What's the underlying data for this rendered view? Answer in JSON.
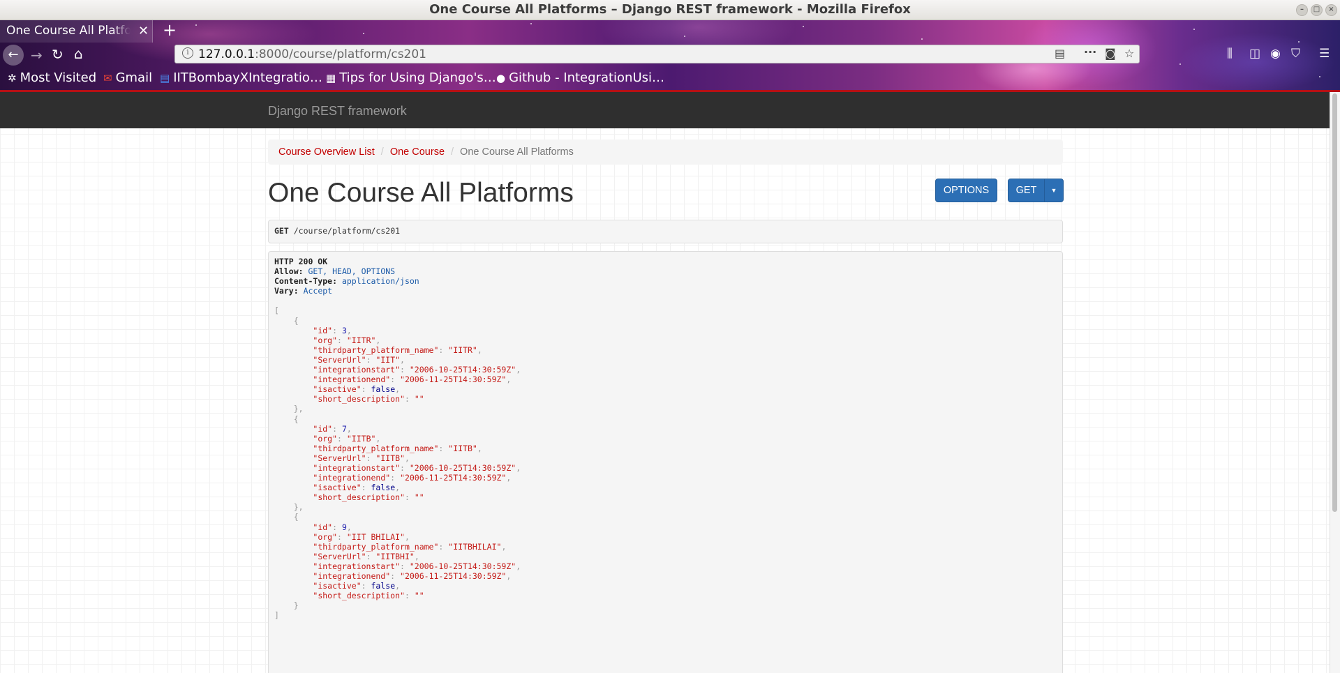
{
  "window": {
    "title": "One Course All Platforms – Django REST framework - Mozilla Firefox"
  },
  "browser": {
    "tab_title": "One Course All Platforms",
    "url_host": "127.0.0.1",
    "url_path": ":8000/course/platform/cs201",
    "bookmarks": [
      {
        "label": "Most Visited",
        "icon": "gear-icon"
      },
      {
        "label": "Gmail",
        "icon": "gmail-icon"
      },
      {
        "label": "IITBombayXIntegratio…",
        "icon": "docs-icon"
      },
      {
        "label": "Tips for Using Django's…",
        "icon": "page-icon"
      },
      {
        "label": "Github - IntegrationUsi…",
        "icon": "github-icon"
      }
    ]
  },
  "drf": {
    "brand": "Django REST framework",
    "breadcrumb": {
      "item1": "Course Overview List",
      "item2": "One Course",
      "current": "One Course All Platforms"
    },
    "page_title": "One Course All Platforms",
    "buttons": {
      "options": "OPTIONS",
      "get": "GET"
    },
    "request": {
      "method": "GET",
      "path": "/course/platform/cs201"
    },
    "response": {
      "status": "HTTP 200 OK",
      "headers": [
        {
          "key": "Allow",
          "value": "GET, HEAD, OPTIONS"
        },
        {
          "key": "Content-Type",
          "value": "application/json"
        },
        {
          "key": "Vary",
          "value": "Accept"
        }
      ],
      "records": [
        {
          "id": 3,
          "org": "IITR",
          "thirdparty_platform_name": "IITR",
          "ServerUrl": "IIT",
          "integrationstart": "2006-10-25T14:30:59Z",
          "integrationend": "2006-11-25T14:30:59Z",
          "isactive": false,
          "short_description": ""
        },
        {
          "id": 7,
          "org": "IITB",
          "thirdparty_platform_name": "IITB",
          "ServerUrl": "IITB",
          "integrationstart": "2006-10-25T14:30:59Z",
          "integrationend": "2006-11-25T14:30:59Z",
          "isactive": false,
          "short_description": ""
        },
        {
          "id": 9,
          "org": "IIT BHILAI",
          "thirdparty_platform_name": "IITBHILAI",
          "ServerUrl": "IITBHI",
          "integrationstart": "2006-10-25T14:30:59Z",
          "integrationend": "2006-11-25T14:30:59Z",
          "isactive": false,
          "short_description": ""
        }
      ]
    }
  },
  "colors": {
    "drf_red": "#c20000",
    "button_blue": "#2c6fb5",
    "navbar": "#2f2f2f"
  }
}
